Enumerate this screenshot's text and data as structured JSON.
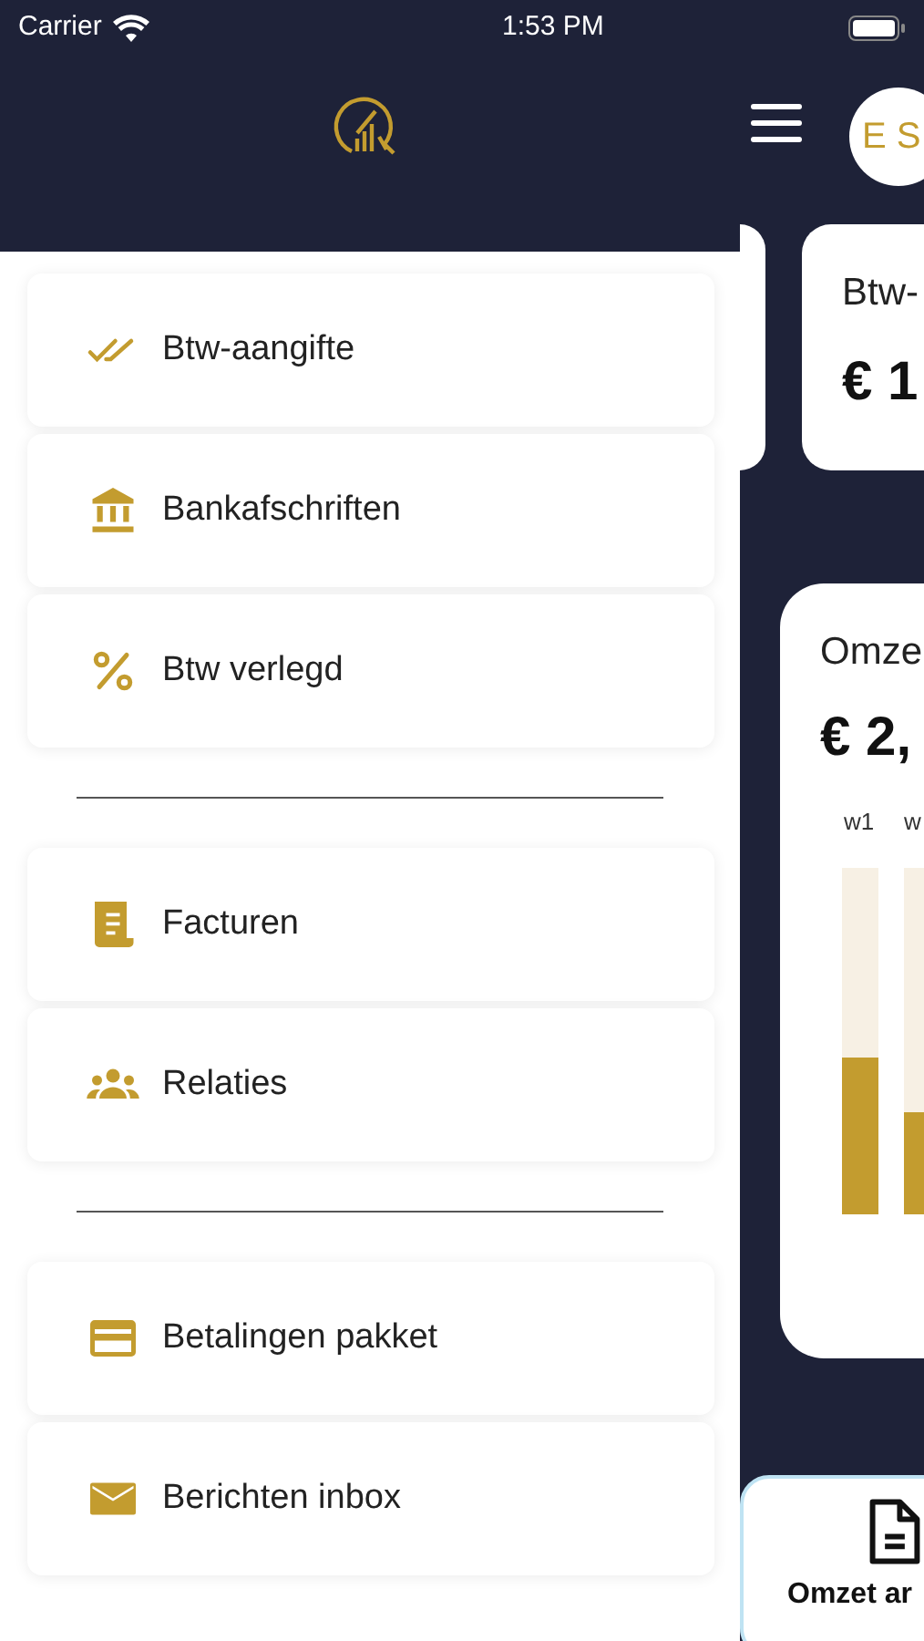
{
  "status_bar": {
    "carrier": "Carrier",
    "time": "1:53 PM"
  },
  "header": {
    "avatar_initials": "E S"
  },
  "menu_groups": [
    [
      {
        "kind": "checks",
        "label": "Btw-aangifte"
      },
      {
        "kind": "bank",
        "label": "Bankafschriften"
      },
      {
        "kind": "percent",
        "label": "Btw verlegd"
      }
    ],
    [
      {
        "kind": "invoice",
        "label": "Facturen"
      },
      {
        "kind": "people",
        "label": "Relaties"
      }
    ],
    [
      {
        "kind": "card",
        "label": "Betalingen pakket"
      },
      {
        "kind": "mail",
        "label": "Berichten inbox"
      }
    ]
  ],
  "vat_card": {
    "title": "Btw-",
    "amount": "€ 1"
  },
  "revenue_card": {
    "title": "Omze",
    "amount": "€ 2,",
    "week_labels": [
      "w1",
      "w"
    ]
  },
  "bottom_card": {
    "label": "Omzet ar"
  }
}
